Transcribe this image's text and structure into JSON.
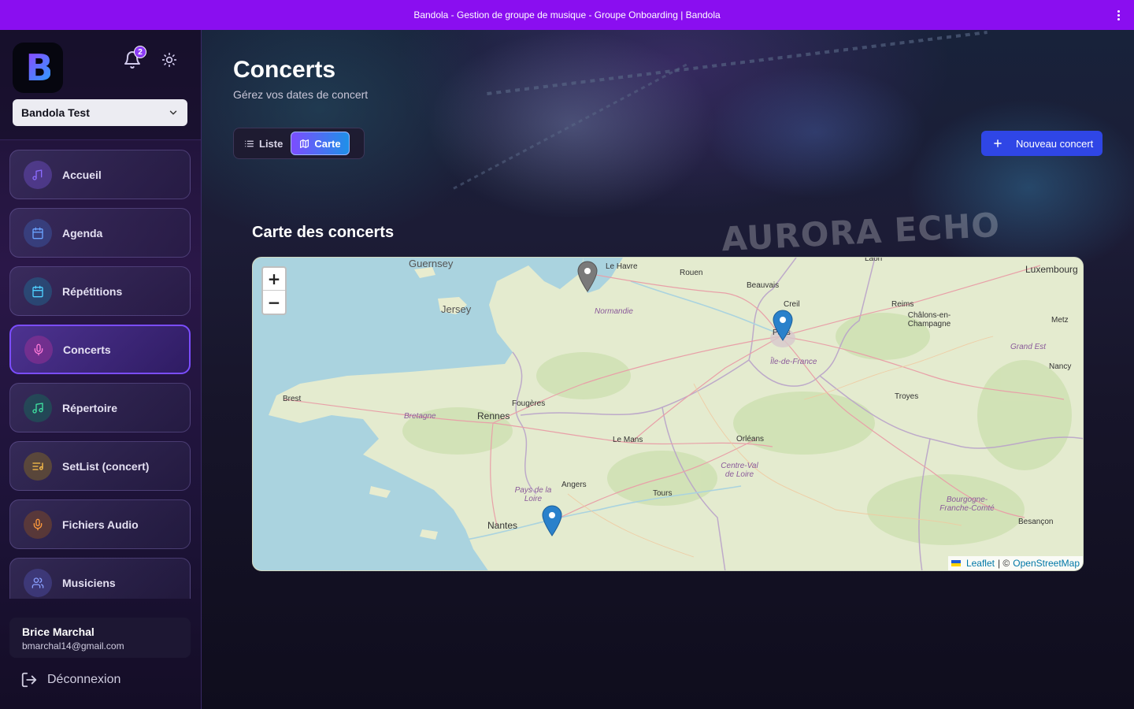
{
  "window": {
    "title": "Bandola - Gestion de groupe de musique - Groupe Onboarding | Bandola"
  },
  "sidebar": {
    "logo_text": "B",
    "notification_count": "2",
    "group_select": "Bandola Test",
    "items": [
      {
        "label": "Accueil",
        "icon": "music-note-icon",
        "color": "#8b6cff",
        "bg": "rgba(110,80,200,0.45)"
      },
      {
        "label": "Agenda",
        "icon": "calendar-icon",
        "color": "#6aa2ff",
        "bg": "rgba(60,90,170,0.45)"
      },
      {
        "label": "Répétitions",
        "icon": "calendar-icon",
        "color": "#4fd0ff",
        "bg": "rgba(30,110,150,0.45)"
      },
      {
        "label": "Concerts",
        "icon": "microphone-icon",
        "color": "#ff7ad9",
        "bg": "rgba(150,50,150,0.55)"
      },
      {
        "label": "Répertoire",
        "icon": "music-notes-icon",
        "color": "#3fe0a0",
        "bg": "rgba(20,110,90,0.45)"
      },
      {
        "label": "SetList (concert)",
        "icon": "list-music-icon",
        "color": "#ffc24a",
        "bg": "rgba(140,110,30,0.45)"
      },
      {
        "label": "Fichiers Audio",
        "icon": "mic-icon",
        "color": "#ff9a3c",
        "bg": "rgba(140,80,30,0.45)"
      },
      {
        "label": "Musiciens",
        "icon": "users-icon",
        "color": "#8aa0ff",
        "bg": "rgba(80,80,170,0.45)"
      }
    ],
    "active_index": 3,
    "user": {
      "name": "Brice Marchal",
      "email": "bmarchal14@gmail.com"
    },
    "logout_label": "Déconnexion"
  },
  "main": {
    "title": "Concerts",
    "subtitle": "Gérez vos dates de concert",
    "view_toggle": {
      "list_label": "Liste",
      "map_label": "Carte",
      "active": "Carte"
    },
    "new_button_label": "Nouveau concert",
    "map_heading": "Carte des concerts",
    "stage_banner_text": "AURORA ECHO",
    "map": {
      "zoom_in": "+",
      "zoom_out": "−",
      "attribution": {
        "leaflet": "Leaflet",
        "separator": "| ©",
        "osm": "OpenStreetMap"
      },
      "seas": [
        "Guernsey",
        "Jersey"
      ],
      "cities": [
        "Le Havre",
        "Rouen",
        "Beauvais",
        "Laon",
        "Luxembourg",
        "Creil",
        "Reims",
        "Châlons-en-Champagne",
        "Metz",
        "Paris",
        "Nancy",
        "Brest",
        "Rennes",
        "Fougères",
        "Troyes",
        "Le Mans",
        "Orléans",
        "Angers",
        "Tours",
        "Nantes",
        "Besançon"
      ],
      "regions": [
        "Normandie",
        "Île-de-France",
        "Grand Est",
        "Bretagne",
        "Centre-Val de Loire",
        "Pays de la Loire",
        "Bourgogne-Franche-Comté"
      ],
      "markers": [
        {
          "name": "Le Havre",
          "color": "#7a7a7a"
        },
        {
          "name": "Paris",
          "color": "#2a81cb"
        },
        {
          "name": "Nantes",
          "color": "#2a81cb"
        }
      ]
    }
  }
}
